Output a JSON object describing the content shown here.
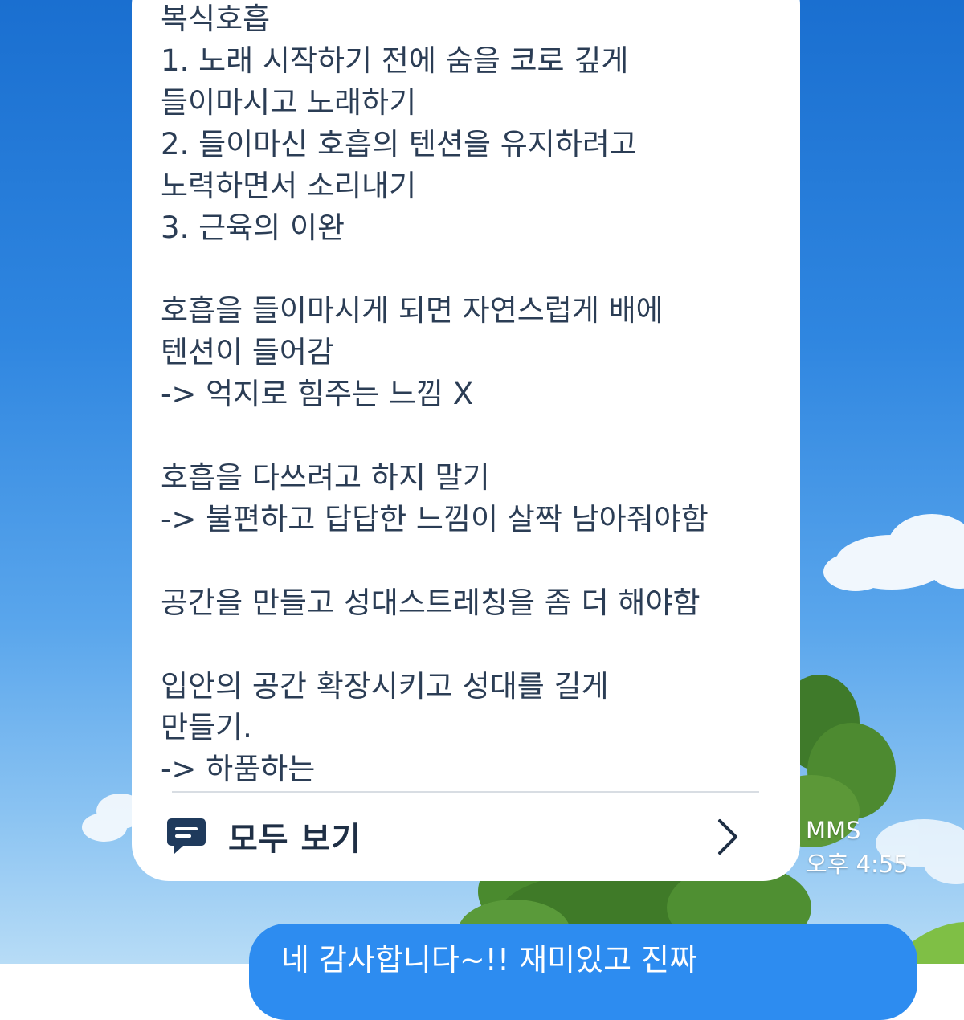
{
  "received_message": {
    "text": "복식호흡\n1. 노래 시작하기 전에 숨을 코로 깊게\n들이마시고 노래하기\n2. 들이마신 호흡의 텐션을 유지하려고\n노력하면서 소리내기\n3. 근육의 이완\n\n호흡을 들이마시게 되면 자연스럽게 배에\n텐션이 들어감\n-> 억지로 힘주는 느낌 X\n\n호흡을 다쓰려고 하지 말기\n-> 불편하고 답답한 느낌이 살짝 남아줘야함\n\n공간을 만들고 성대스트레칭을 좀 더 해야함\n\n입안의 공간 확장시키고 성대를 길게\n만들기.\n-> 하품하는",
    "view_all_label": "모두 보기",
    "view_all_icon": "chat-bubble-icon",
    "chevron_icon": "chevron-right-icon",
    "type_label": "MMS",
    "time": "오후 4:55"
  },
  "sent_message": {
    "text": "네 감사합니다~!! 재미있고 진짜"
  },
  "colors": {
    "received_bubble": "#ffffff",
    "received_text": "#2b3d55",
    "sent_bubble": "#2d8cf0",
    "sent_text": "#ffffff",
    "meta_text": "#ffffff",
    "view_all_icon": "#1f3a5c"
  }
}
